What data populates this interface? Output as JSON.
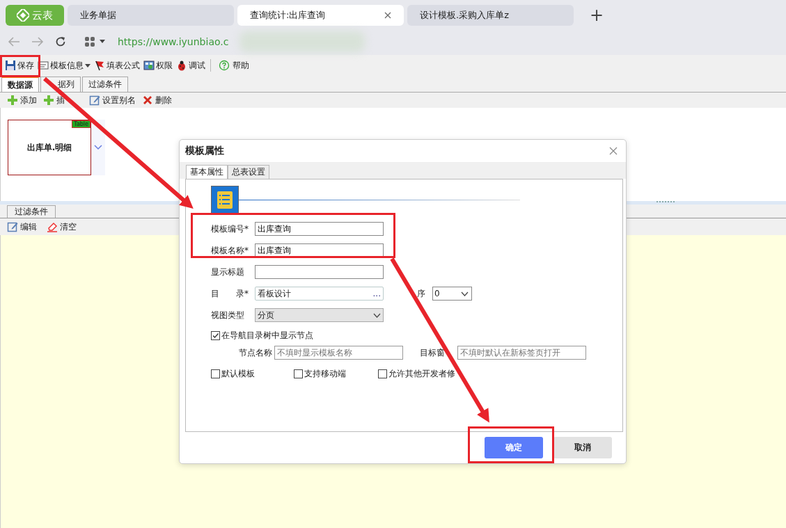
{
  "browser": {
    "tabs": [
      {
        "label": "云表",
        "kind": "logo",
        "selected": false,
        "closable": false
      },
      {
        "label": "业务单据",
        "kind": "page",
        "selected": false,
        "closable": false
      },
      {
        "label": "查询统计:出库查询",
        "kind": "page",
        "selected": true,
        "closable": true
      },
      {
        "label": "设计模板.采购入库单z",
        "kind": "page",
        "selected": false,
        "closable": false
      }
    ],
    "new_tab": "+",
    "url": "https://www.iyunbiao.c"
  },
  "toolbar": [
    {
      "label": "保存",
      "kind": "save",
      "dropdown": false
    },
    {
      "label": "模板信息",
      "kind": "info",
      "dropdown": true
    },
    {
      "label": "填表公式",
      "kind": "formula",
      "dropdown": false
    },
    {
      "label": "权限",
      "kind": "permission",
      "dropdown": false
    },
    {
      "label": "调试",
      "kind": "debug",
      "dropdown": false
    },
    {
      "label": "帮助",
      "kind": "help",
      "dropdown": false
    }
  ],
  "designer_tabs": [
    {
      "label": "数据源",
      "selected": true
    },
    {
      "label": "据列",
      "selected": false
    },
    {
      "label": "过滤条件",
      "selected": false
    }
  ],
  "source_actions": [
    {
      "label": "添加",
      "kind": "add"
    },
    {
      "label": "插",
      "kind": "add"
    },
    {
      "label": "设置别名",
      "kind": "edit"
    },
    {
      "label": "删除",
      "kind": "delete"
    }
  ],
  "table_node": {
    "name": "出库单.明细",
    "badge": "Table"
  },
  "filter_panel": {
    "tab": "过滤条件",
    "actions": [
      {
        "label": "编辑",
        "kind": "edit"
      },
      {
        "label": "清空",
        "kind": "eraser"
      }
    ]
  },
  "dialog": {
    "title": "模板属性",
    "tabs": [
      {
        "label": "基本属性",
        "selected": true
      },
      {
        "label": "总表设置",
        "selected": false
      }
    ],
    "fields": [
      {
        "label": "模板编号*",
        "value": "出库查询",
        "kind": "text"
      },
      {
        "label": "模板名称*",
        "value": "出库查询",
        "kind": "text"
      },
      {
        "label": "显示标题",
        "kind": "text"
      },
      {
        "label": "目　　录*",
        "value": "看板设计",
        "kind": "picker",
        "trigger": "...",
        "extra_label": "序",
        "extra_value": "0"
      },
      {
        "label": "视图类型",
        "value": "分页",
        "kind": "select"
      }
    ],
    "nav_option": {
      "label": "在导航目录树中显示节点",
      "checked": true,
      "fields": [
        {
          "label": "节点名称",
          "placeholder": "不填时显示模板名称"
        },
        {
          "label": "目标窗",
          "placeholder": "不填时默认在新标签页打开"
        }
      ]
    },
    "options": [
      {
        "label": "默认模板",
        "checked": false
      },
      {
        "label": "支持移动端",
        "checked": false
      },
      {
        "label": "允许其他开发者修",
        "checked": false
      }
    ],
    "buttons": [
      {
        "label": "确定",
        "kind": "primary"
      },
      {
        "label": "取消",
        "kind": "secondary"
      }
    ]
  }
}
